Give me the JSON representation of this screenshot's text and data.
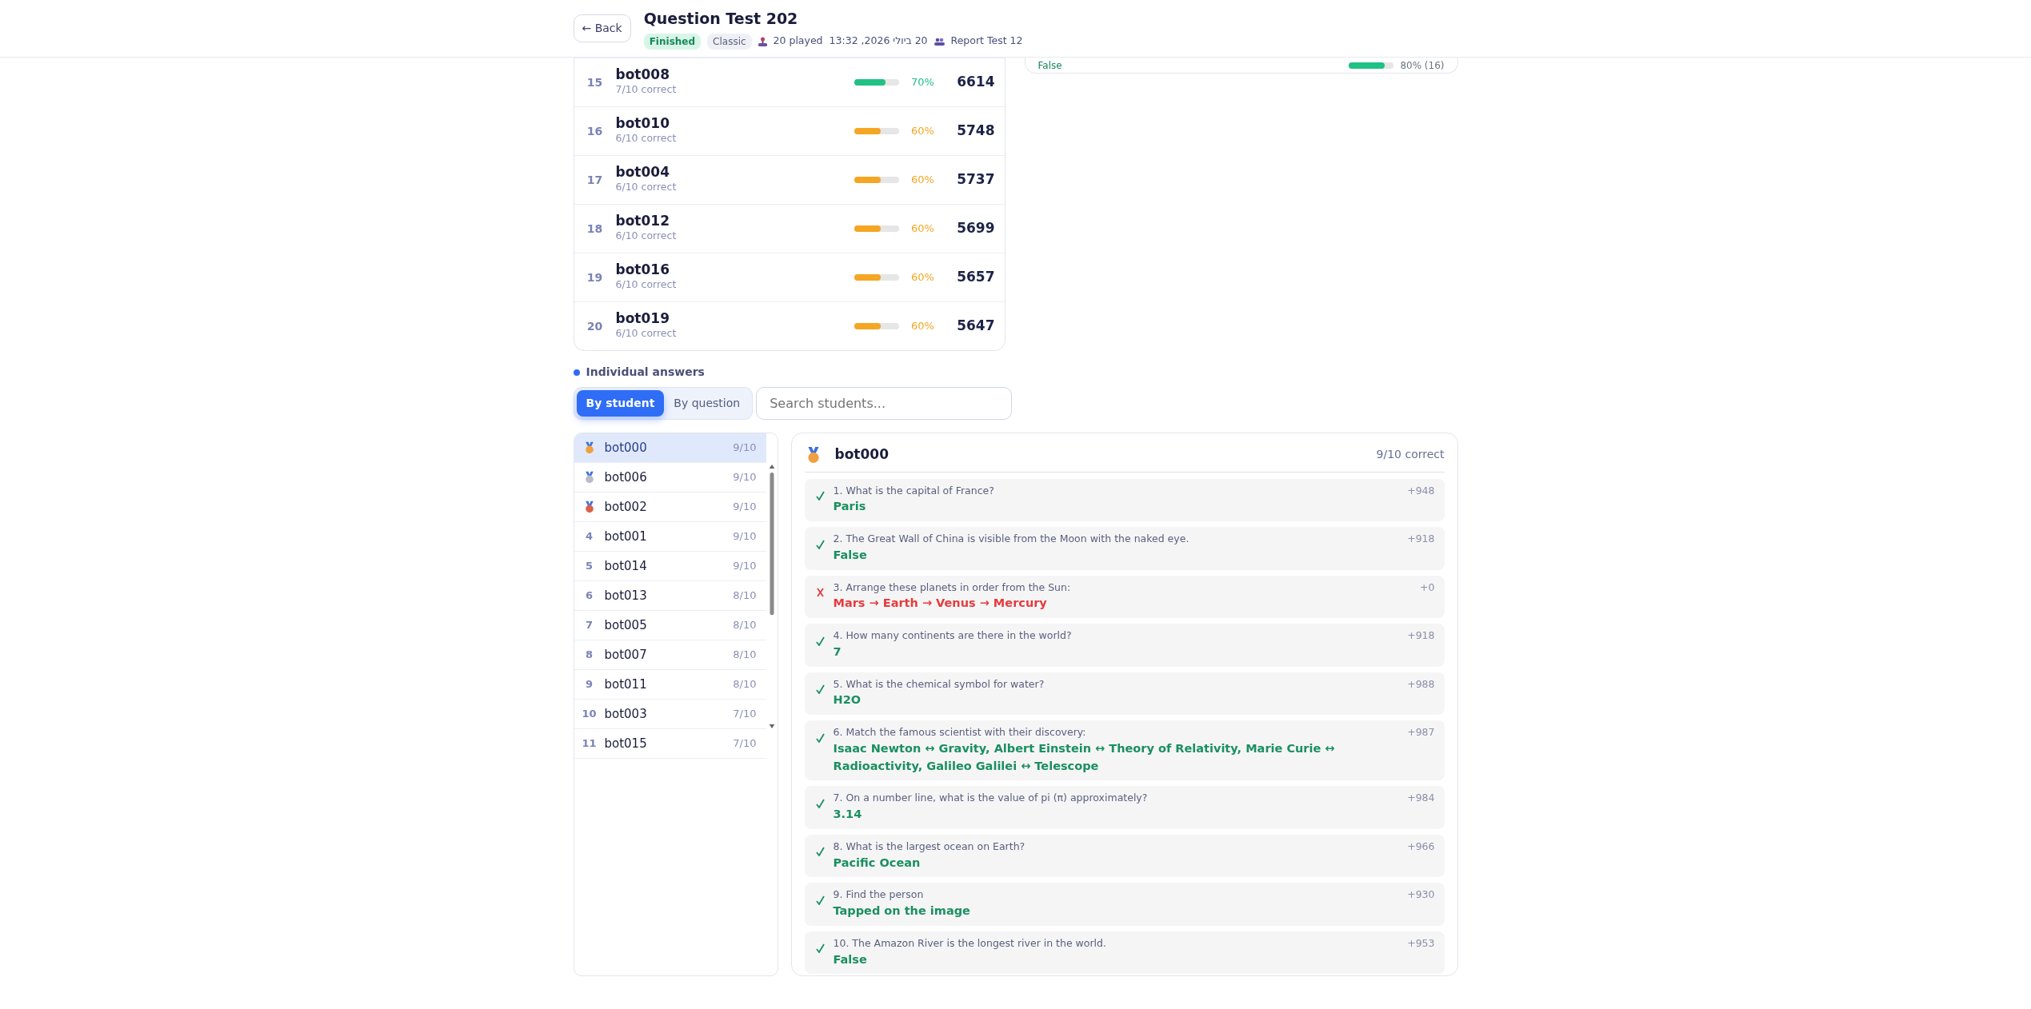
{
  "header": {
    "back": "← Back",
    "title": "Question Test 202",
    "status": "Finished",
    "mode": "Classic",
    "played": "20 played",
    "date": "20 ביולי 2026, 13:32",
    "report": "Report Test 12"
  },
  "leaderboard": [
    {
      "rank": "15",
      "name": "bot008",
      "sub": "7/10 correct",
      "level": 0.7,
      "pct": "70%",
      "color": "#20c185",
      "score": "6614"
    },
    {
      "rank": "16",
      "name": "bot010",
      "sub": "6/10 correct",
      "level": 0.6,
      "pct": "60%",
      "color": "#f5a623",
      "score": "5748"
    },
    {
      "rank": "17",
      "name": "bot004",
      "sub": "6/10 correct",
      "level": 0.6,
      "pct": "60%",
      "color": "#f5a623",
      "score": "5737"
    },
    {
      "rank": "18",
      "name": "bot012",
      "sub": "6/10 correct",
      "level": 0.6,
      "pct": "60%",
      "color": "#f5a623",
      "score": "5699"
    },
    {
      "rank": "19",
      "name": "bot016",
      "sub": "6/10 correct",
      "level": 0.6,
      "pct": "60%",
      "color": "#f5a623",
      "score": "5657"
    },
    {
      "rank": "20",
      "name": "bot019",
      "sub": "6/10 correct",
      "level": 0.6,
      "pct": "60%",
      "color": "#f5a623",
      "score": "5647"
    }
  ],
  "option_stat": {
    "label": "False",
    "level": 0.8,
    "reading": "80% (16)"
  },
  "individual": {
    "title": "Individual answers",
    "tabs": [
      {
        "label": "By student",
        "selected": true
      },
      {
        "label": "By question",
        "selected": false
      }
    ],
    "search": {
      "placeholder": "Search students..."
    },
    "students": [
      {
        "color": "#f0a040",
        "name": "bot000",
        "score": "9/10",
        "selected": true
      },
      {
        "color": "#b9bcc8",
        "name": "bot006",
        "score": "9/10",
        "selected": false
      },
      {
        "color": "#d9624a",
        "name": "bot002",
        "score": "9/10",
        "selected": false
      },
      {
        "rank": "4",
        "name": "bot001",
        "score": "9/10",
        "selected": false
      },
      {
        "rank": "5",
        "name": "bot014",
        "score": "9/10",
        "selected": false
      },
      {
        "rank": "6",
        "name": "bot013",
        "score": "8/10",
        "selected": false
      },
      {
        "rank": "7",
        "name": "bot005",
        "score": "8/10",
        "selected": false
      },
      {
        "rank": "8",
        "name": "bot007",
        "score": "8/10",
        "selected": false
      },
      {
        "rank": "9",
        "name": "bot011",
        "score": "8/10",
        "selected": false
      },
      {
        "rank": "10",
        "name": "bot003",
        "score": "7/10",
        "selected": false
      },
      {
        "rank": "11",
        "name": "bot015",
        "score": "7/10",
        "selected": false
      }
    ],
    "detail": {
      "color": "#f0a040",
      "name": "bot000",
      "summary": "9/10 correct",
      "answers": [
        {
          "question": "1. What is the capital of France?",
          "answer": "Paris",
          "points": "+948",
          "correct": true
        },
        {
          "question": "2. The Great Wall of China is visible from the Moon with the naked eye.",
          "answer": "False",
          "points": "+918",
          "correct": true
        },
        {
          "question": "3. Arrange these planets in order from the Sun:",
          "answer": "Mars → Earth → Venus → Mercury",
          "points": "+0",
          "correct": false
        },
        {
          "question": "4. How many continents are there in the world?",
          "answer": "7",
          "points": "+918",
          "correct": true
        },
        {
          "question": "5. What is the chemical symbol for water?",
          "answer": "H2O",
          "points": "+988",
          "correct": true
        },
        {
          "question": "6. Match the famous scientist with their discovery:",
          "answer": "Isaac Newton ↔ Gravity, Albert Einstein ↔ Theory of Relativity, Marie Curie ↔ Radioactivity, Galileo Galilei ↔ Telescope",
          "points": "+987",
          "correct": true
        },
        {
          "question": "7. On a number line, what is the value of pi (π) approximately?",
          "answer": "3.14",
          "points": "+984",
          "correct": true
        },
        {
          "question": "8. What is the largest ocean on Earth?",
          "answer": "Pacific Ocean",
          "points": "+966",
          "correct": true
        },
        {
          "question": "9. Find the person",
          "answer": "Tapped on the image",
          "points": "+930",
          "correct": true
        },
        {
          "question": "10. The Amazon River is the longest river in the world.",
          "answer": "False",
          "points": "+953",
          "correct": true
        }
      ]
    }
  }
}
